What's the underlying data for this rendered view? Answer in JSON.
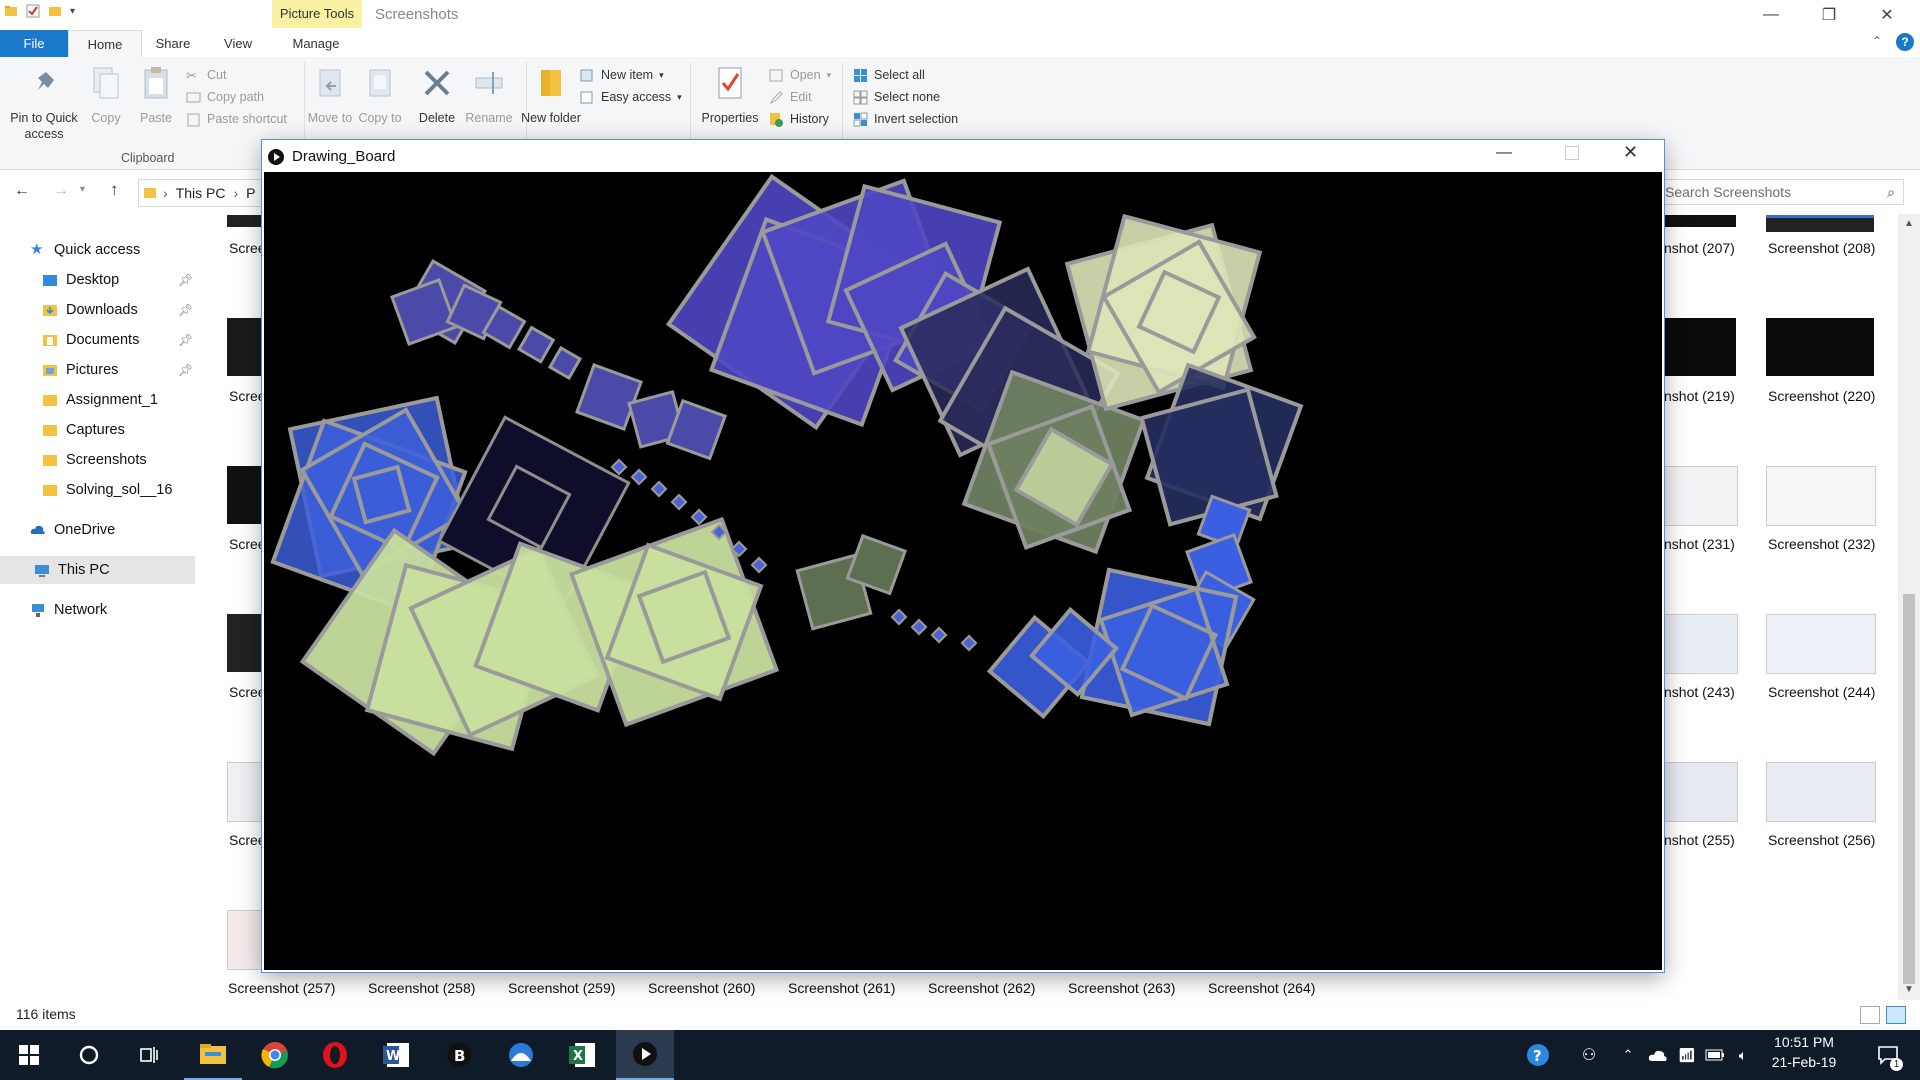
{
  "explorer": {
    "context_tab": "Picture Tools",
    "title": "Screenshots",
    "tabs": {
      "file": "File",
      "home": "Home",
      "share": "Share",
      "view": "View",
      "manage": "Manage"
    },
    "ribbon": {
      "pin": "Pin to Quick access",
      "copy": "Copy",
      "paste": "Paste",
      "cut": "Cut",
      "copy_path": "Copy path",
      "paste_shortcut": "Paste shortcut",
      "clipboard_group": "Clipboard",
      "move_to": "Move to",
      "copy_to": "Copy to",
      "delete": "Delete",
      "rename": "Rename",
      "new_folder": "New folder",
      "new_item": "New item",
      "easy_access": "Easy access",
      "properties": "Properties",
      "open": "Open",
      "edit": "Edit",
      "history": "History",
      "select_all": "Select all",
      "select_none": "Select none",
      "invert_selection": "Invert selection"
    },
    "address": {
      "segment1": "This PC",
      "segment2": "P"
    },
    "search_placeholder": "Search Screenshots",
    "nav": {
      "quick_access": "Quick access",
      "desktop": "Desktop",
      "downloads": "Downloads",
      "documents": "Documents",
      "pictures": "Pictures",
      "assignment": "Assignment_1",
      "captures": "Captures",
      "screenshots": "Screenshots",
      "solving": "Solving_sol__16",
      "onedrive": "OneDrive",
      "this_pc": "This PC",
      "network": "Network"
    },
    "left_labels": [
      "Scree",
      "Scree",
      "Scree",
      "Scree",
      "Scree"
    ],
    "right_col1": [
      "nshot (207)",
      "nshot (219)",
      "nshot (231)",
      "nshot (243)",
      "nshot (255)"
    ],
    "right_col2": [
      "Screenshot (208)",
      "Screenshot (220)",
      "Screenshot (232)",
      "Screenshot (244)",
      "Screenshot (256)"
    ],
    "bottom_row": [
      "Screenshot (257)",
      "Screenshot (258)",
      "Screenshot (259)",
      "Screenshot (260)",
      "Screenshot (261)",
      "Screenshot (262)",
      "Screenshot (263)",
      "Screenshot (264)"
    ],
    "status": "116 items"
  },
  "drawing_window": {
    "title": "Drawing_Board"
  },
  "taskbar": {
    "time": "10:51 PM",
    "date": "21-Feb-19",
    "notification_count": "1"
  },
  "icons": [
    "search-icon",
    "windows-start-icon",
    "cortana-icon",
    "task-view-icon",
    "file-explorer-icon",
    "chrome-icon",
    "opera-icon",
    "word-icon",
    "excel-icon",
    "play-icon"
  ]
}
